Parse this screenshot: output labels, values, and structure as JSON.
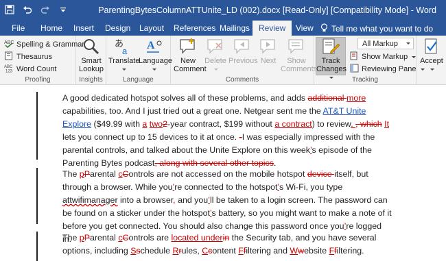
{
  "window": {
    "title": "ParentingBytesColumnATTUnite_LD (002).docx [Read-Only] [Compatibility Mode] - Word"
  },
  "tabs": [
    "File",
    "Home",
    "Insert",
    "Design",
    "Layout",
    "References",
    "Mailings",
    "Review",
    "View"
  ],
  "tell_me": "Tell me what you want to do",
  "ribbon": {
    "proofing": {
      "spelling": "Spelling & Grammar",
      "thesaurus": "Thesaurus",
      "word_count": "Word Count",
      "label": "Proofing"
    },
    "insights": {
      "smart_lookup": "Smart Lookup",
      "label": "Insights"
    },
    "language": {
      "translate": "Translate",
      "language": "Language",
      "label": "Language"
    },
    "comments": {
      "new": "New Comment",
      "delete": "Delete",
      "previous": "Previous",
      "next": "Next",
      "show": "Show Comments",
      "label": "Comments"
    },
    "tracking": {
      "track_changes": "Track Changes",
      "markup_select": "All Markup",
      "show_markup": "Show Markup",
      "reviewing_pane": "Reviewing Pane",
      "label": "Tracking"
    },
    "changes": {
      "accept": "Accept"
    }
  },
  "document": {
    "p1": [
      {
        "t": "A good dedicated hotspot solves all of these problems, and adds "
      },
      {
        "t": "additional ",
        "s": "del"
      },
      {
        "t": "more",
        "s": "ins"
      },
      {
        "t": " capabilities, too. And I just tried out a great one. Netgear sent me the "
      },
      {
        "t": "AT&T Unite Explore",
        "s": "lnk"
      },
      {
        "t": " ($49.99 with "
      },
      {
        "t": "a",
        "s": "ins"
      },
      {
        "t": " "
      },
      {
        "t": "two",
        "s": "ins"
      },
      {
        "t": "2",
        "s": "del"
      },
      {
        "t": "-year contract, $199 without "
      },
      {
        "t": "a contract",
        "s": "ins"
      },
      {
        "t": ") to review"
      },
      {
        "t": ". ",
        "s": "ins"
      },
      {
        "t": ", which",
        "s": "del"
      },
      {
        "t": " "
      },
      {
        "t": "It",
        "s": "ins"
      },
      {
        "t": " lets you connect up to 15 devices to it at once. "
      },
      {
        "t": "-",
        "s": "del"
      },
      {
        "t": "I was especially impressed with the parental controls, and talked about the Unite Explore on this week"
      },
      {
        "t": "’",
        "s": "ins"
      },
      {
        "t": "s episode of the Parenting Bytes podcast"
      },
      {
        "t": ", along with several other topics",
        "s": "del"
      },
      {
        "t": "."
      }
    ],
    "p2": [
      {
        "t": "The "
      },
      {
        "t": "p",
        "s": "ins"
      },
      {
        "t": "P",
        "s": "del"
      },
      {
        "t": "arental "
      },
      {
        "t": "c",
        "s": "ins"
      },
      {
        "t": "C",
        "s": "del"
      },
      {
        "t": "ontrols are not accessed on the mobile hotspot "
      },
      {
        "t": "device ",
        "s": "del"
      },
      {
        "t": "itself, but through a browser. While you"
      },
      {
        "t": "’",
        "s": "ins"
      },
      {
        "t": "re connected to the hotspot"
      },
      {
        "t": "’",
        "s": "ins"
      },
      {
        "t": "s Wi-Fi, you type "
      },
      {
        "t": "attwifimanager",
        "s": "sq"
      },
      {
        "t": " into a browser"
      },
      {
        "t": ",",
        "s": "ins"
      },
      {
        "t": " and you"
      },
      {
        "t": "’",
        "s": "ins"
      },
      {
        "t": "ll be taken to a login screen. The password can be found on a sticker under the hotspot"
      },
      {
        "t": "’",
        "s": "ins"
      },
      {
        "t": "s battery, so you might want to make a note of it before you get connected. You should also change this password once you"
      },
      {
        "t": "’",
        "s": "ins"
      },
      {
        "t": "re logged in."
      }
    ],
    "p3": [
      {
        "t": "The "
      },
      {
        "t": "p",
        "s": "ins"
      },
      {
        "t": "P",
        "s": "del"
      },
      {
        "t": "arental "
      },
      {
        "t": "c",
        "s": "ins"
      },
      {
        "t": "C",
        "s": "del"
      },
      {
        "t": "ontrols are "
      },
      {
        "t": "located ",
        "s": "ins"
      },
      {
        "t": "under",
        "s": "ins"
      },
      {
        "t": "in",
        "s": "del"
      },
      {
        "t": " the Security tab, and you have several options, including "
      },
      {
        "t": "S",
        "s": "ins"
      },
      {
        "t": "s",
        "s": "del"
      },
      {
        "t": "chedule "
      },
      {
        "t": "R",
        "s": "ins"
      },
      {
        "t": "r",
        "s": "del"
      },
      {
        "t": "ules, "
      },
      {
        "t": "C",
        "s": "ins"
      },
      {
        "t": "c",
        "s": "del"
      },
      {
        "t": "ontent "
      },
      {
        "t": "F",
        "s": "ins"
      },
      {
        "t": "f",
        "s": "del"
      },
      {
        "t": "iltering and "
      },
      {
        "t": "W",
        "s": "ins"
      },
      {
        "t": "w",
        "s": "del"
      },
      {
        "t": "ebsite "
      },
      {
        "t": "F",
        "s": "ins"
      },
      {
        "t": "f",
        "s": "del"
      },
      {
        "t": "iltering."
      }
    ]
  },
  "colors": {
    "title_bar": "#2b579a",
    "ribbon_bg": "#f3f3f3",
    "revision": "#c00000",
    "link": "#1a55c4"
  }
}
